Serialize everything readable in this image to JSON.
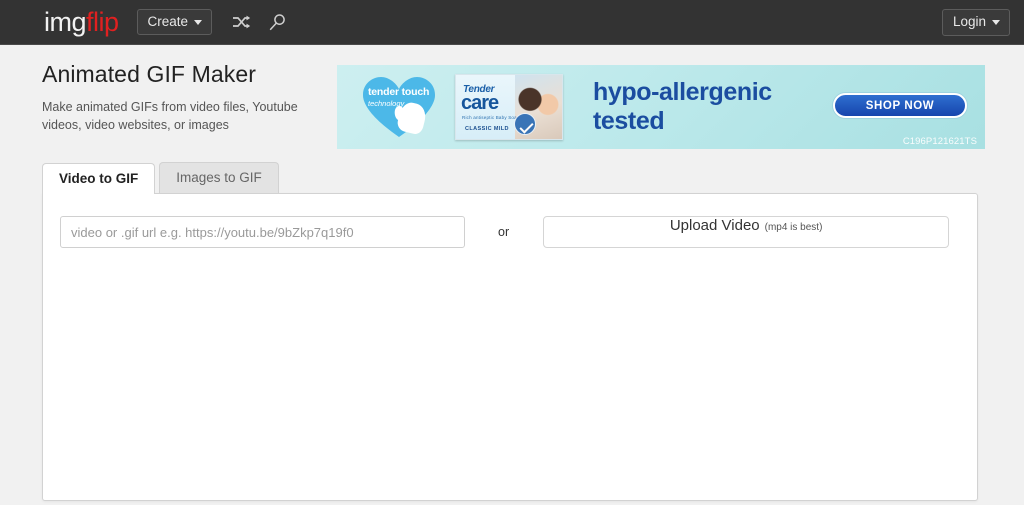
{
  "topbar": {
    "logo_img": "img",
    "logo_flip": "flip",
    "create_label": "Create",
    "shuffle_icon": "shuffle-icon",
    "search_icon": "search-icon",
    "login_label": "Login"
  },
  "page": {
    "title": "Animated GIF Maker",
    "subtitle": "Make animated GIFs from video files, Youtube videos, video websites, or images"
  },
  "ad": {
    "heart_line1": "tender touch",
    "heart_line2": "technology",
    "product_brand_top": "Tender",
    "product_brand_main": "care",
    "product_tagline": "Rich antiseptic Baby Soap",
    "product_variant": "CLASSIC MILD",
    "headline_line1": "hypo-allergenic",
    "headline_line2": "tested",
    "cta_label": "SHOP NOW",
    "code": "C196P121621TS",
    "bg_color": "#bfeaec",
    "headline_color": "#1b4da0",
    "cta_color": "#1645ad"
  },
  "tabs": [
    {
      "label": "Video to GIF",
      "active": true
    },
    {
      "label": "Images to GIF",
      "active": false
    }
  ],
  "source": {
    "url_value": "",
    "url_placeholder": "video or .gif url e.g. https://youtu.be/9bZkp7q19f0",
    "or_label": "or",
    "upload_label": "Upload Video",
    "upload_note": "(mp4 is best)"
  }
}
